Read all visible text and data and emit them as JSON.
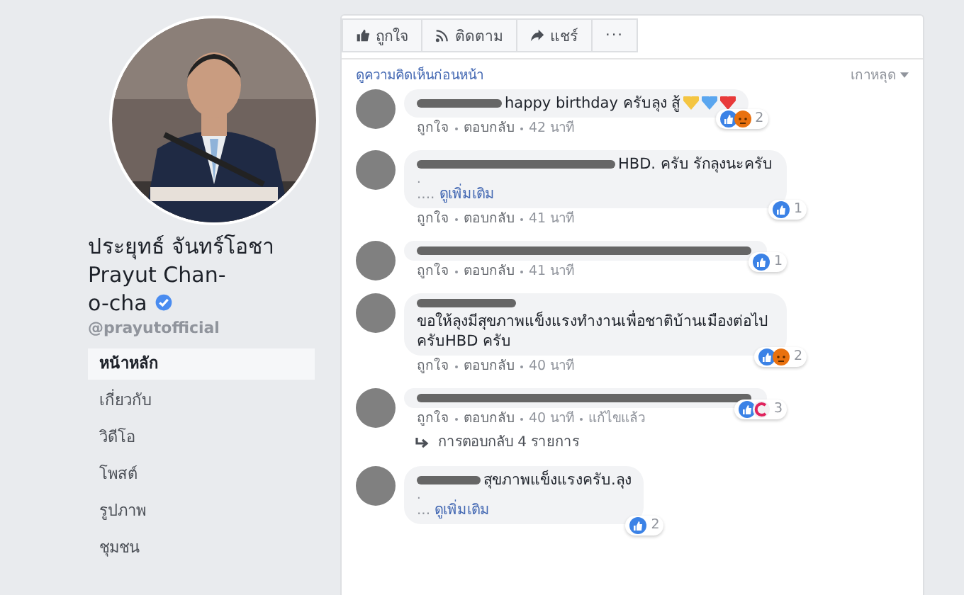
{
  "profile": {
    "name_thai": "ประยุทธ์ จันทร์โอชา",
    "name_en": "Prayut Chan-o-cha",
    "verified": true,
    "handle": "@prayutofficial"
  },
  "nav": [
    {
      "label": "หน้าหลัก",
      "selected": true
    },
    {
      "label": "เกี่ยวกับ",
      "selected": false
    },
    {
      "label": "วิดีโอ",
      "selected": false
    },
    {
      "label": "โพสต์",
      "selected": false
    },
    {
      "label": "รูปภาพ",
      "selected": false
    },
    {
      "label": "ชุมชน",
      "selected": false
    }
  ],
  "actions": [
    {
      "kind": "like",
      "label": "ถูกใจ"
    },
    {
      "kind": "follow",
      "label": "ติดตาม"
    },
    {
      "kind": "share",
      "label": "แชร์"
    },
    {
      "kind": "more",
      "label": "···"
    }
  ],
  "comments_header": {
    "previous": "ดูความคิดเห็นก่อนหน้า",
    "sort": "เกาหลุด"
  },
  "comments": [
    {
      "text": "happy birthday ครับลุง สู้",
      "emoji": [
        {
          "color": "#f4c542"
        },
        {
          "color": "#5aa6ef"
        },
        {
          "color": "#e83a3a"
        }
      ],
      "reactions": [
        {
          "kind": "like"
        },
        {
          "kind": "angry"
        }
      ],
      "count": "2",
      "meta": [
        "ถูกใจ",
        "ตอบกลับ",
        "42 นาที"
      ]
    },
    {
      "text": "HBD. ครับ รักลุงนะครับ",
      "more": {
        "dot": ".",
        "prefix": "....",
        "label": "ดูเพิ่มเติม"
      },
      "reactions": [
        {
          "kind": "like"
        }
      ],
      "count": "1",
      "meta": [
        "ถูกใจ",
        "ตอบกลับ",
        "41 นาที"
      ]
    },
    {
      "reactions": [
        {
          "kind": "like"
        }
      ],
      "count": "1",
      "meta": [
        "ถูกใจ",
        "ตอบกลับ",
        "41 นาที"
      ]
    },
    {
      "text": "ขอให้ลุงมีสุขภาพแข็งแรงทำงานเพื่อชาติบ้านเมืองต่อไปครับHBD ครับ",
      "reactions": [
        {
          "kind": "like"
        },
        {
          "kind": "angry"
        }
      ],
      "count": "2",
      "meta": [
        "ถูกใจ",
        "ตอบกลับ",
        "40 นาที"
      ]
    },
    {
      "reactions": [
        {
          "kind": "like"
        },
        {
          "kind": "love"
        }
      ],
      "count": "3",
      "meta": [
        "ถูกใจ",
        "ตอบกลับ",
        "40 นาที",
        "แก้ไขแล้ว"
      ],
      "replies": "การตอบกลับ 4 รายการ"
    },
    {
      "text": "สุขภาพแข็งแรงครับ.ลุง",
      "more": {
        "dot": ".",
        "prefix": "...",
        "label": "ดูเพิ่มเติม"
      },
      "reactions": [
        {
          "kind": "like"
        }
      ],
      "count": "2"
    }
  ]
}
